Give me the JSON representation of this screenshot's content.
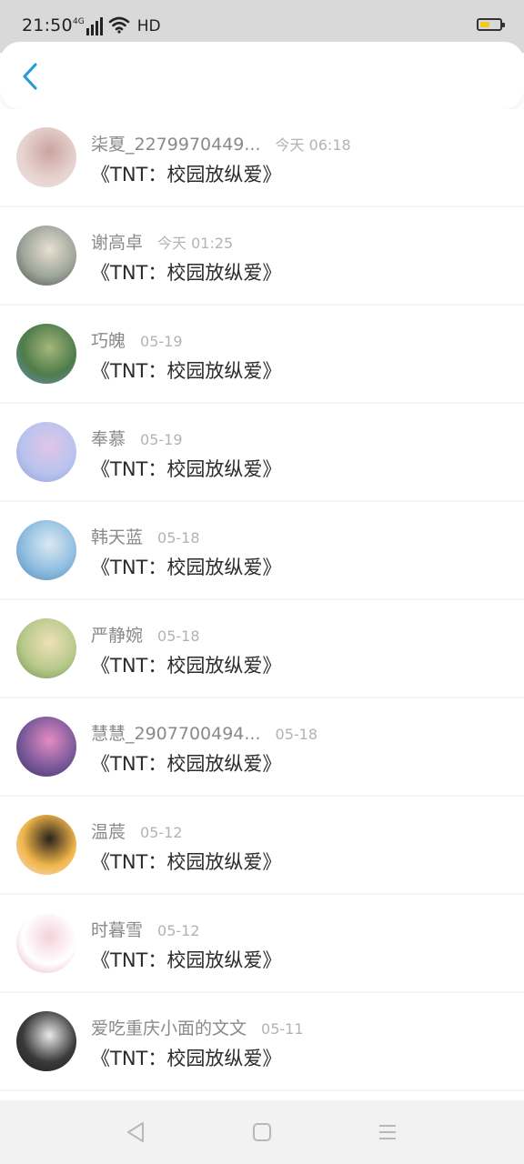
{
  "status_bar": {
    "time": "21:50",
    "network": "4G",
    "hd": "HD",
    "icons": [
      "signal-icon",
      "wifi-icon",
      "battery-icon"
    ],
    "battery_color": "#f5cb1b"
  },
  "header": {
    "back_icon": "chevron-left-icon",
    "accent": "#1e9bd7"
  },
  "items": [
    {
      "user": "柒夏_2279970449...",
      "time": "今天 06:18",
      "title": "《TNT：校园放纵爱》",
      "avatar_colors": [
        "#e6d2cf",
        "#caa39e",
        "#f1e3dc"
      ]
    },
    {
      "user": "谢高卓",
      "time": "今天 01:25",
      "title": "《TNT：校园放纵爱》",
      "avatar_colors": [
        "#9ea59a",
        "#e7e0d0",
        "#4a4a44"
      ]
    },
    {
      "user": "巧魄",
      "time": "05-19",
      "title": "《TNT：校园放纵爱》",
      "avatar_colors": [
        "#4e7c4a",
        "#a6b67a",
        "#6b8fbe"
      ]
    },
    {
      "user": "奉慕",
      "time": "05-19",
      "title": "《TNT：校园放纵爱》",
      "avatar_colors": [
        "#b9c4ee",
        "#e1c5e6",
        "#8f9bd6"
      ]
    },
    {
      "user": "韩天蓝",
      "time": "05-18",
      "title": "《TNT：校园放纵爱》",
      "avatar_colors": [
        "#8fbde0",
        "#dbe9f3",
        "#4c86b8"
      ]
    },
    {
      "user": "严静婉",
      "time": "05-18",
      "title": "《TNT：校园放纵爱》",
      "avatar_colors": [
        "#b7c98b",
        "#f0e0b8",
        "#6e8c4c"
      ]
    },
    {
      "user": "慧慧_2907700494...",
      "time": "05-18",
      "title": "《TNT：校园放纵爱》",
      "avatar_colors": [
        "#7b5a9a",
        "#e58bc2",
        "#3c3064"
      ]
    },
    {
      "user": "温莀",
      "time": "05-12",
      "title": "《TNT：校园放纵爱》",
      "avatar_colors": [
        "#f0b64a",
        "#2a221c",
        "#f6e4d6"
      ]
    },
    {
      "user": "时暮雪",
      "time": "05-12",
      "title": "《TNT：校园放纵爱》",
      "avatar_colors": [
        "#ffffff",
        "#f4d2dc",
        "#e8a7bb"
      ]
    },
    {
      "user": "爱吃重庆小面的文文",
      "time": "05-11",
      "title": "《TNT：校园放纵爱》",
      "avatar_colors": [
        "#3a3a3a",
        "#e9e9e9",
        "#1b1b1b"
      ]
    }
  ],
  "nav": {
    "icons": [
      "back-triangle-icon",
      "home-square-icon",
      "menu-lines-icon"
    ]
  }
}
